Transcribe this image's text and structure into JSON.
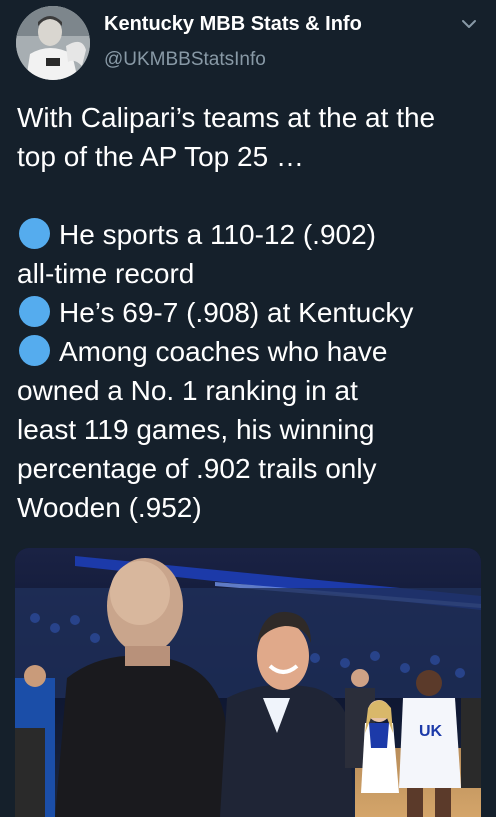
{
  "tweet": {
    "display_name": "Kentucky MBB Stats & Info",
    "handle": "@UKMBBStatsInfo",
    "lines": [
      "With Calipari’s teams at the at the",
      "top of the AP Top 25 …",
      "He sports a 110-12 (.902)",
      "all-time record",
      "He’s 69-7 (.908) at Kentucky",
      "Among coaches who have",
      "owned a No. 1 ranking in at",
      "least 119 games, his winning",
      "percentage of .902 trails only",
      "Wooden (.952)"
    ]
  },
  "icons": {
    "bullet": "blue-circle-emoji",
    "caret": "chevron-down-icon"
  },
  "colors": {
    "background": "#15202b",
    "text": "#ffffff",
    "secondary_text": "#8899a6",
    "bullet_blue": "#55acee",
    "kentucky_blue": "#1c3aa9"
  }
}
